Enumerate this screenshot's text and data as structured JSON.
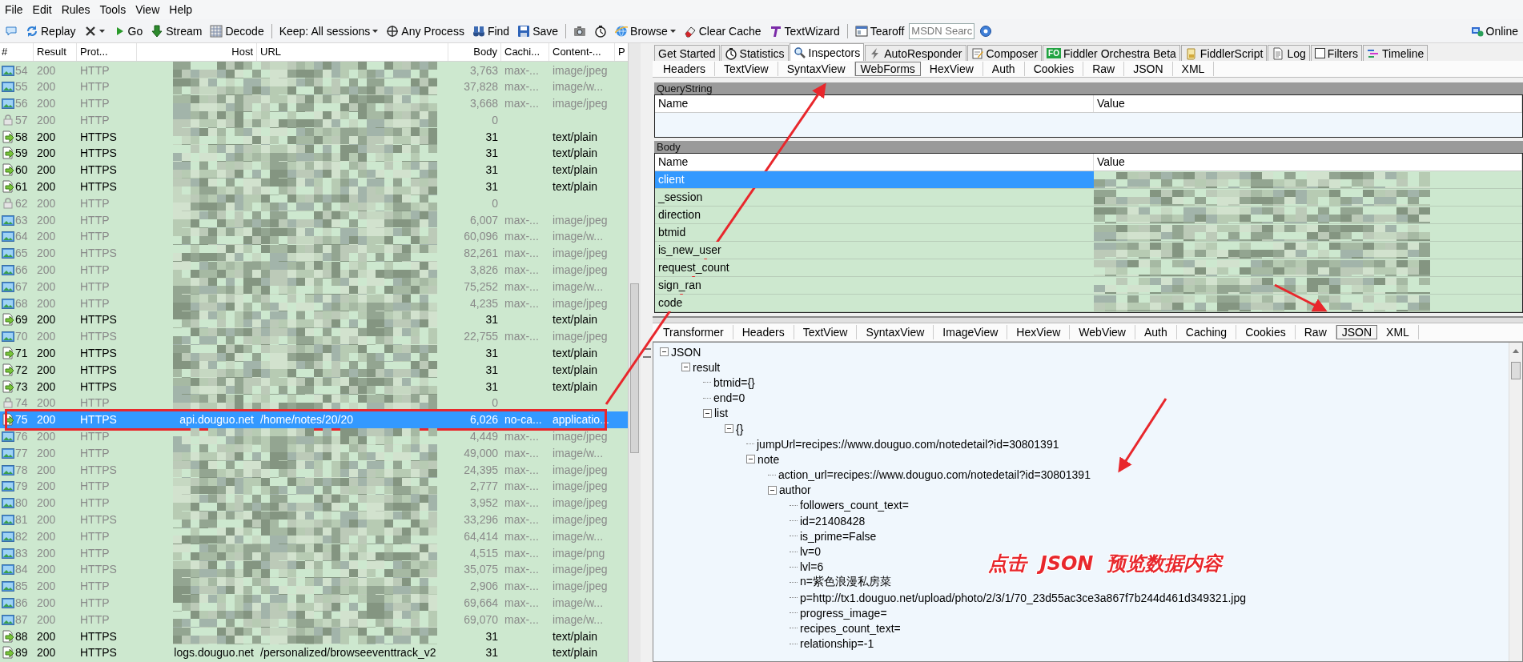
{
  "menu": [
    "File",
    "Edit",
    "Rules",
    "Tools",
    "View",
    "Help"
  ],
  "toolbar": [
    {
      "kind": "icon"
    },
    {
      "kind": "button",
      "label": "Replay"
    },
    {
      "kind": "dropdown-icon"
    },
    {
      "kind": "button",
      "label": "Go"
    },
    {
      "kind": "button",
      "label": "Stream"
    },
    {
      "kind": "button",
      "label": "Decode"
    },
    {
      "kind": "separator"
    },
    {
      "kind": "dropdown",
      "label": "Keep: All sessions"
    },
    {
      "kind": "button",
      "label": "Any Process"
    },
    {
      "kind": "button",
      "label": "Find"
    },
    {
      "kind": "button",
      "label": "Save"
    },
    {
      "kind": "separator"
    },
    {
      "kind": "icon"
    },
    {
      "kind": "icon"
    },
    {
      "kind": "dropdown",
      "label": "Browse"
    },
    {
      "kind": "button",
      "label": "Clear Cache"
    },
    {
      "kind": "button",
      "label": "TextWizard"
    },
    {
      "kind": "separator"
    },
    {
      "kind": "button",
      "label": "Tearoff"
    },
    {
      "kind": "search",
      "placeholder": "MSDN Searc"
    },
    {
      "kind": "icon"
    }
  ],
  "online": {
    "label": "Online"
  },
  "sessions": {
    "columns": [
      "#",
      "Result",
      "Prot...",
      "Host",
      "URL",
      "Body",
      "Cachi...",
      "Content-...",
      "P"
    ],
    "rows": [
      {
        "num": "54",
        "result": "200",
        "protocol": "HTTP",
        "body": "3,763",
        "caching": "max-...",
        "content_type": "image/jpeg",
        "kind": "image",
        "selected": false
      },
      {
        "num": "55",
        "result": "200",
        "protocol": "HTTP",
        "body": "37,828",
        "caching": "max-...",
        "content_type": "image/w...",
        "kind": "image",
        "selected": false
      },
      {
        "num": "56",
        "result": "200",
        "protocol": "HTTP",
        "body": "3,668",
        "caching": "max-...",
        "content_type": "image/jpeg",
        "kind": "image",
        "selected": false
      },
      {
        "num": "57",
        "result": "200",
        "protocol": "HTTP",
        "body": "0",
        "kind": "lock",
        "selected": false
      },
      {
        "num": "58",
        "result": "200",
        "protocol": "HTTPS",
        "body": "31",
        "content_type": "text/plain",
        "kind": "response",
        "selected": false
      },
      {
        "num": "59",
        "result": "200",
        "protocol": "HTTPS",
        "body": "31",
        "content_type": "text/plain",
        "kind": "response",
        "selected": false
      },
      {
        "num": "60",
        "result": "200",
        "protocol": "HTTPS",
        "body": "31",
        "content_type": "text/plain",
        "kind": "response",
        "selected": false
      },
      {
        "num": "61",
        "result": "200",
        "protocol": "HTTPS",
        "body": "31",
        "content_type": "text/plain",
        "kind": "response",
        "selected": false
      },
      {
        "num": "62",
        "result": "200",
        "protocol": "HTTP",
        "body": "0",
        "kind": "lock",
        "selected": false
      },
      {
        "num": "63",
        "result": "200",
        "protocol": "HTTP",
        "body": "6,007",
        "caching": "max-...",
        "content_type": "image/jpeg",
        "kind": "image",
        "selected": false
      },
      {
        "num": "64",
        "result": "200",
        "protocol": "HTTP",
        "body": "60,096",
        "caching": "max-...",
        "content_type": "image/w...",
        "kind": "image",
        "selected": false
      },
      {
        "num": "65",
        "result": "200",
        "protocol": "HTTPS",
        "body": "82,261",
        "caching": "max-...",
        "content_type": "image/jpeg",
        "kind": "image",
        "selected": false
      },
      {
        "num": "66",
        "result": "200",
        "protocol": "HTTP",
        "body": "3,826",
        "caching": "max-...",
        "content_type": "image/jpeg",
        "kind": "image",
        "selected": false
      },
      {
        "num": "67",
        "result": "200",
        "protocol": "HTTP",
        "body": "75,252",
        "caching": "max-...",
        "content_type": "image/w...",
        "kind": "image",
        "selected": false
      },
      {
        "num": "68",
        "result": "200",
        "protocol": "HTTP",
        "body": "4,235",
        "caching": "max-...",
        "content_type": "image/jpeg",
        "kind": "image",
        "selected": false
      },
      {
        "num": "69",
        "result": "200",
        "protocol": "HTTPS",
        "body": "31",
        "content_type": "text/plain",
        "kind": "response",
        "selected": false
      },
      {
        "num": "70",
        "result": "200",
        "protocol": "HTTPS",
        "body": "22,755",
        "caching": "max-...",
        "content_type": "image/jpeg",
        "kind": "image",
        "selected": false
      },
      {
        "num": "71",
        "result": "200",
        "protocol": "HTTPS",
        "body": "31",
        "content_type": "text/plain",
        "kind": "response",
        "selected": false
      },
      {
        "num": "72",
        "result": "200",
        "protocol": "HTTPS",
        "body": "31",
        "content_type": "text/plain",
        "kind": "response",
        "selected": false
      },
      {
        "num": "73",
        "result": "200",
        "protocol": "HTTPS",
        "body": "31",
        "content_type": "text/plain",
        "kind": "response",
        "selected": false
      },
      {
        "num": "74",
        "result": "200",
        "protocol": "HTTP",
        "body": "0",
        "kind": "lock",
        "selected": false
      },
      {
        "num": "75",
        "result": "200",
        "protocol": "HTTPS",
        "host": "api.douguo.net",
        "url": "/home/notes/20/20",
        "body": "6,026",
        "caching": "no-ca...",
        "content_type": "applicatio...",
        "kind": "response",
        "selected": true
      },
      {
        "num": "76",
        "result": "200",
        "protocol": "HTTP",
        "body": "4,449",
        "caching": "max-...",
        "content_type": "image/jpeg",
        "kind": "image",
        "selected": false
      },
      {
        "num": "77",
        "result": "200",
        "protocol": "HTTP",
        "body": "49,000",
        "caching": "max-...",
        "content_type": "image/w...",
        "kind": "image",
        "selected": false
      },
      {
        "num": "78",
        "result": "200",
        "protocol": "HTTPS",
        "body": "24,395",
        "caching": "max-...",
        "content_type": "image/jpeg",
        "kind": "image",
        "selected": false
      },
      {
        "num": "79",
        "result": "200",
        "protocol": "HTTP",
        "body": "2,777",
        "caching": "max-...",
        "content_type": "image/jpeg",
        "kind": "image",
        "selected": false
      },
      {
        "num": "80",
        "result": "200",
        "protocol": "HTTP",
        "body": "3,952",
        "caching": "max-...",
        "content_type": "image/jpeg",
        "kind": "image",
        "selected": false
      },
      {
        "num": "81",
        "result": "200",
        "protocol": "HTTPS",
        "body": "33,296",
        "caching": "max-...",
        "content_type": "image/jpeg",
        "kind": "image",
        "selected": false
      },
      {
        "num": "82",
        "result": "200",
        "protocol": "HTTP",
        "body": "64,414",
        "caching": "max-...",
        "content_type": "image/w...",
        "kind": "image",
        "selected": false
      },
      {
        "num": "83",
        "result": "200",
        "protocol": "HTTP",
        "body": "4,515",
        "caching": "max-...",
        "content_type": "image/png",
        "kind": "image",
        "selected": false
      },
      {
        "num": "84",
        "result": "200",
        "protocol": "HTTPS",
        "body": "35,075",
        "caching": "max-...",
        "content_type": "image/jpeg",
        "kind": "image",
        "selected": false
      },
      {
        "num": "85",
        "result": "200",
        "protocol": "HTTP",
        "body": "2,906",
        "caching": "max-...",
        "content_type": "image/jpeg",
        "kind": "image",
        "selected": false
      },
      {
        "num": "86",
        "result": "200",
        "protocol": "HTTP",
        "body": "69,664",
        "caching": "max-...",
        "content_type": "image/w...",
        "kind": "image",
        "selected": false
      },
      {
        "num": "87",
        "result": "200",
        "protocol": "HTTP",
        "body": "69,070",
        "caching": "max-...",
        "content_type": "image/w...",
        "kind": "image",
        "selected": false
      },
      {
        "num": "88",
        "result": "200",
        "protocol": "HTTPS",
        "body": "31",
        "content_type": "text/plain",
        "kind": "response",
        "selected": false
      },
      {
        "num": "89",
        "result": "200",
        "protocol": "HTTPS",
        "host": "logs.douguo.net",
        "url": "/personalized/browseeventtrack_v2",
        "body": "31",
        "content_type": "text/plain",
        "kind": "response",
        "selected": false
      }
    ]
  },
  "main_tabs": [
    {
      "label": "Get Started",
      "kind": "plain",
      "selected": false
    },
    {
      "label": "Statistics",
      "kind": "icon",
      "selected": false
    },
    {
      "label": "Inspectors",
      "kind": "icon",
      "selected": true
    },
    {
      "label": "AutoResponder",
      "kind": "icon",
      "selected": false
    },
    {
      "label": "Composer",
      "kind": "icon",
      "selected": false
    },
    {
      "label": "Fiddler Orchestra Beta",
      "kind": "badge",
      "badge": "FO",
      "selected": false
    },
    {
      "label": "FiddlerScript",
      "kind": "icon",
      "selected": false
    },
    {
      "label": "Log",
      "kind": "icon",
      "selected": false
    },
    {
      "label": "Filters",
      "kind": "checkbox",
      "checked": false,
      "selected": false
    },
    {
      "label": "Timeline",
      "kind": "icon",
      "selected": false
    }
  ],
  "request": {
    "tabs": [
      {
        "label": "Headers",
        "selected": false
      },
      {
        "label": "TextView",
        "selected": false
      },
      {
        "label": "SyntaxView",
        "selected": false
      },
      {
        "label": "WebForms",
        "selected": true
      },
      {
        "label": "HexView",
        "selected": false
      },
      {
        "label": "Auth",
        "selected": false
      },
      {
        "label": "Cookies",
        "selected": false
      },
      {
        "label": "Raw",
        "selected": false
      },
      {
        "label": "JSON",
        "selected": false
      },
      {
        "label": "XML",
        "selected": false
      }
    ],
    "query_string": {
      "title": "QueryString",
      "columns": [
        "Name",
        "Value"
      ]
    },
    "body": {
      "title": "Body",
      "columns": [
        "Name",
        "Value"
      ],
      "rows": [
        {
          "name": "client",
          "selected": true
        },
        {
          "name": "_session",
          "selected": false
        },
        {
          "name": "direction",
          "selected": false
        },
        {
          "name": "btmid",
          "selected": false
        },
        {
          "name": "is_new_user",
          "selected": false
        },
        {
          "name": "request_count",
          "selected": false
        },
        {
          "name": "sign_ran",
          "selected": false
        },
        {
          "name": "code",
          "selected": false
        }
      ]
    }
  },
  "response": {
    "tabs": [
      {
        "label": "Transformer",
        "selected": false
      },
      {
        "label": "Headers",
        "selected": false
      },
      {
        "label": "TextView",
        "selected": false
      },
      {
        "label": "SyntaxView",
        "selected": false
      },
      {
        "label": "ImageView",
        "selected": false
      },
      {
        "label": "HexView",
        "selected": false
      },
      {
        "label": "WebView",
        "selected": false
      },
      {
        "label": "Auth",
        "selected": false
      },
      {
        "label": "Caching",
        "selected": false
      },
      {
        "label": "Cookies",
        "selected": false
      },
      {
        "label": "Raw",
        "selected": false
      },
      {
        "label": "JSON",
        "selected": true
      },
      {
        "label": "XML",
        "selected": false
      }
    ],
    "tree": [
      {
        "label": "JSON",
        "expanded": true,
        "children": [
          {
            "label": "result",
            "expanded": true,
            "children": [
              {
                "label": "btmid={}"
              },
              {
                "label": "end=0"
              },
              {
                "label": "list",
                "expanded": true,
                "children": [
                  {
                    "label": "{}",
                    "expanded": true,
                    "children": [
                      {
                        "label": "jumpUrl=recipes://www.douguo.com/notedetail?id=30801391"
                      },
                      {
                        "label": "note",
                        "expanded": true,
                        "children": [
                          {
                            "label": "action_url=recipes://www.douguo.com/notedetail?id=30801391"
                          },
                          {
                            "label": "author",
                            "expanded": true,
                            "children": [
                              {
                                "label": "followers_count_text="
                              },
                              {
                                "label": "id=21408428"
                              },
                              {
                                "label": "is_prime=False"
                              },
                              {
                                "label": "lv=0"
                              },
                              {
                                "label": "lvl=6"
                              },
                              {
                                "label": "n=紫色浪漫私房菜"
                              },
                              {
                                "label": "p=http://tx1.douguo.net/upload/photo/2/3/1/70_23d55ac3ce3a867f7b244d461d349321.jpg"
                              },
                              {
                                "label": "progress_image="
                              },
                              {
                                "label": "recipes_count_text="
                              },
                              {
                                "label": "relationship=-1"
                              }
                            ]
                          }
                        ]
                      }
                    ]
                  }
                ]
              }
            ]
          }
        ]
      }
    ]
  },
  "annotation": {
    "label": "点击  JSON  预览数据内容"
  }
}
